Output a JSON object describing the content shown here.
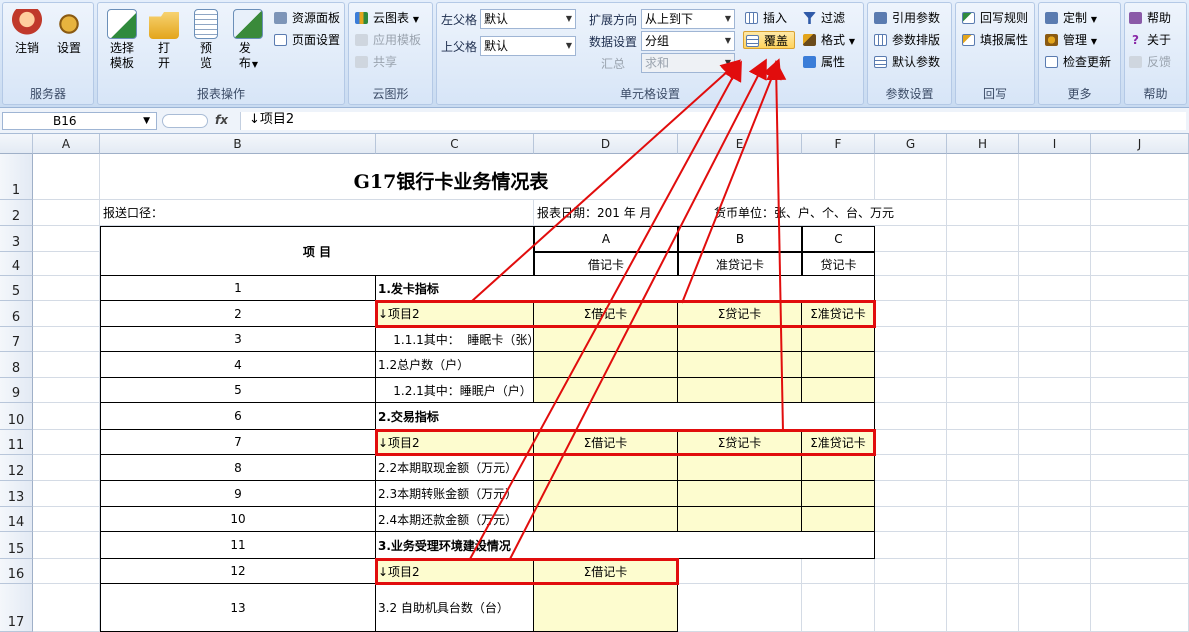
{
  "ribbon": {
    "groups": [
      {
        "label": "服务器"
      },
      {
        "label": "报表操作"
      },
      {
        "label": "云图形"
      },
      {
        "label": "单元格设置"
      },
      {
        "label": "参数设置"
      },
      {
        "label": "回写"
      },
      {
        "label": "更多"
      },
      {
        "label": "帮助"
      }
    ],
    "server": {
      "logout": "注销",
      "settings": "设置"
    },
    "report": {
      "select_template": "选择模板",
      "open": "打开",
      "preview": "预览",
      "publish": "发布",
      "resource_panel": "资源面板",
      "page_setup": "页面设置"
    },
    "cloud": {
      "cloud_chart": "云图表",
      "app_template": "应用模板",
      "share": "共享"
    },
    "cell": {
      "left_parent": "左父格",
      "left_parent_value": "默认",
      "top_parent": "上父格",
      "top_parent_value": "默认",
      "expand_dir": "扩展方向",
      "expand_dir_value": "从上到下",
      "data_setting": "数据设置",
      "data_setting_value": "分组",
      "summary": "汇总",
      "summary_value": "求和",
      "insert": "插入",
      "overwrite": "覆盖",
      "filter": "过滤",
      "format": "格式",
      "property": "属性"
    },
    "param": {
      "ref_param": "引用参数",
      "param_layout": "参数排版",
      "default_param": "默认参数"
    },
    "writeback": {
      "rule": "回写规则",
      "fill_property": "填报属性"
    },
    "more": {
      "custom": "定制",
      "manage": "管理",
      "check_update": "检查更新"
    },
    "help": {
      "help": "帮助",
      "about": "关于",
      "feedback": "反馈"
    }
  },
  "formula_bar": {
    "cell_ref": "B16",
    "fx": "fx",
    "content": "↓项目2"
  },
  "columns": [
    "A",
    "B",
    "C",
    "D",
    "E",
    "F",
    "G",
    "H",
    "I",
    "J"
  ],
  "rows": [
    "1",
    "2",
    "3",
    "4",
    "5",
    "6",
    "7",
    "8",
    "9",
    "10",
    "11",
    "12",
    "13",
    "14",
    "15",
    "16",
    "17"
  ],
  "sheet": {
    "title": "G17银行卡业务情况表",
    "row2_a": "报送口径：",
    "row2_c": "报表日期：201   年   月",
    "row2_d": "货币单位：张、户、个、台、万元",
    "hdr_item": "项      目",
    "col_a": "A",
    "col_b": "B",
    "col_c": "C",
    "card_debit": "借记卡",
    "card_quasi": "准贷记卡",
    "card_credit": "贷记卡",
    "lines": [
      {
        "num": "1",
        "text": "1.发卡指标"
      },
      {
        "num": "2",
        "text": "↓项目2",
        "c": "Σ借记卡",
        "d": "Σ贷记卡",
        "e": "Σ准贷记卡"
      },
      {
        "num": "3",
        "text": "    1.1.1其中：  睡眠卡（张）"
      },
      {
        "num": "4",
        "text": "1.2总户数（户）"
      },
      {
        "num": "5",
        "text": "    1.2.1其中：睡眠户（户）"
      },
      {
        "num": "6",
        "text": "2.交易指标"
      },
      {
        "num": "7",
        "text": "↓项目2",
        "c": "Σ借记卡",
        "d": "Σ贷记卡",
        "e": "Σ准贷记卡"
      },
      {
        "num": "8",
        "text": "2.2本期取现金额（万元）"
      },
      {
        "num": "9",
        "text": "2.3本期转账金额（万元）"
      },
      {
        "num": "10",
        "text": "2.4本期还款金额（万元）"
      },
      {
        "num": "11",
        "text": "3.业务受理环境建设情况"
      },
      {
        "num": "12",
        "text": "↓项目2",
        "c": "Σ借记卡"
      },
      {
        "num": "13",
        "text": "3.2 自助机具台数（台）"
      }
    ]
  },
  "colors": {
    "annotation": "#e10d0d",
    "yellow_fill": "#fdfccf"
  }
}
